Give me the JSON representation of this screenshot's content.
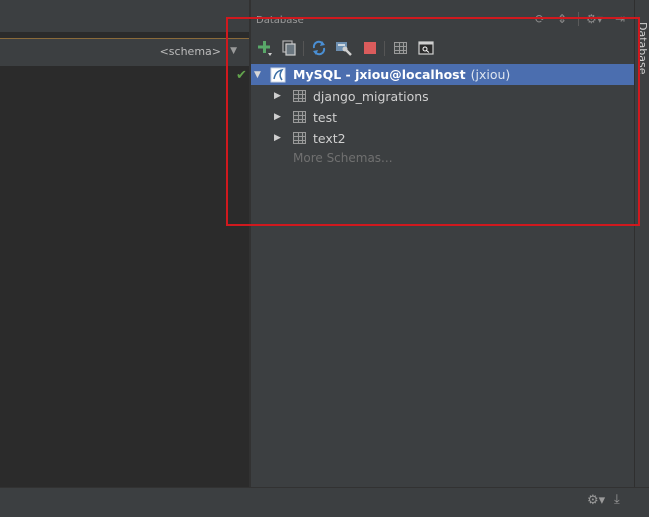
{
  "editor": {
    "schema_selector": "<schema>",
    "schema_arrow": "▼",
    "check_icon": "✔"
  },
  "database_panel": {
    "title": "Database",
    "header_icons": {
      "sync": "⟳",
      "collapse": "⇕",
      "settings": "⚙▾",
      "hide": "⇥"
    },
    "tree": {
      "datasource": {
        "name": "MySQL - jxiou@localhost",
        "user": "(jxiou)",
        "arrow": "▼"
      },
      "tables": [
        {
          "name": "django_migrations",
          "arrow": "▶"
        },
        {
          "name": "test",
          "arrow": "▶"
        },
        {
          "name": "text2",
          "arrow": "▶"
        }
      ],
      "more_schemas": "More Schemas..."
    }
  },
  "side_tab": {
    "label": "Database"
  },
  "bottom_bar": {
    "gear": "⚙▾",
    "download": "⤓"
  },
  "colors": {
    "panel_bg": "#3c3f41",
    "editor_bg": "#2b2b2b",
    "selection": "#4b6eaf",
    "highlight_box": "#d0191e",
    "add_green": "#59a869",
    "stop_red": "#db5c5c"
  }
}
